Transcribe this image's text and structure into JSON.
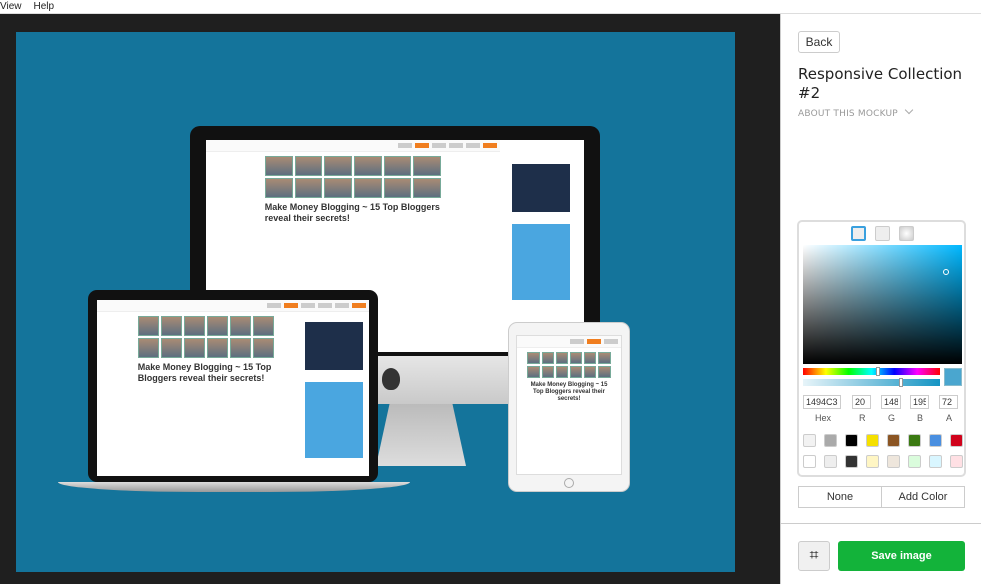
{
  "menu": {
    "items": [
      "View",
      "Help"
    ]
  },
  "mockup": {
    "headline": "Make Money Blogging ~ 15 Top Bloggers reveal their secrets!",
    "background_color": "#14749b"
  },
  "panel": {
    "back_label": "Back",
    "title": "Responsive Collection #2",
    "about_label": "ABOUT THIS MOCKUP",
    "picker": {
      "hex": "1494C3",
      "r": "20",
      "g": "148",
      "b": "195",
      "a": "72",
      "labels": {
        "hex": "Hex",
        "r": "R",
        "g": "G",
        "b": "B",
        "a": "A"
      },
      "swatches_row1": [
        "#f2f2f2",
        "#aaaaaa",
        "#000000",
        "#f5e000",
        "#8b5523",
        "#3b7a12",
        "#4a8fe0",
        "#d0021b"
      ],
      "swatches_row2": [
        "#ffffff",
        "#eeeeee",
        "#333333",
        "#fff6c4",
        "#eee6dc",
        "#dafcdc",
        "#d9f6ff",
        "#ffe0e4"
      ]
    },
    "none_label": "None",
    "add_color_label": "Add Color",
    "crop_icon": "crop-icon",
    "save_label": "Save image",
    "accent": "#13b33a"
  }
}
